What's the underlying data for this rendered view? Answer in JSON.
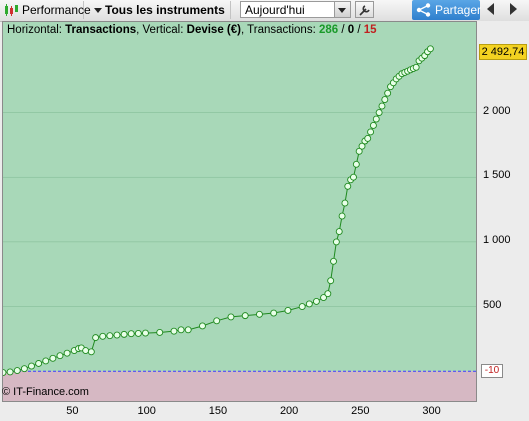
{
  "toolbar": {
    "performance_label": "Performance",
    "instruments_label": "Tous les instruments",
    "period_value": "Aujourd'hui",
    "share_label": "Partager"
  },
  "info": {
    "prefix": "Horizontal:",
    "horizontal": "Transactions",
    "vertical_prefix": ", Vertical:",
    "vertical": "Devise (€)",
    "tx_prefix": ", Transactions:",
    "tx_total": "286",
    "sep1": " / ",
    "tx_zero": "0",
    "sep2": " / ",
    "tx_loss": "15"
  },
  "credit": "© IT-Finance.com",
  "last_value_label": "2 492,74",
  "neg_label": "-10",
  "colors": {
    "profit_bg": "#a8d8b8",
    "loss_bg": "#d6b8c3",
    "line": "#1f8a1f",
    "marker": "#e8ffe8",
    "last_tag": "#f3d221"
  },
  "chart_data": {
    "type": "line",
    "y_ticks": [
      "500",
      "1 000",
      "1 500",
      "2 000"
    ],
    "x_ticks": [
      "50",
      "100",
      "150",
      "200",
      "250",
      "300"
    ],
    "xlim": [
      0,
      332
    ],
    "ylim": [
      -230,
      2700
    ],
    "x": [
      0,
      5,
      10,
      15,
      20,
      25,
      30,
      35,
      40,
      45,
      50,
      53,
      55,
      58,
      62,
      65,
      70,
      75,
      80,
      85,
      90,
      95,
      100,
      110,
      120,
      125,
      130,
      140,
      150,
      160,
      170,
      180,
      190,
      200,
      210,
      215,
      220,
      225,
      228,
      230,
      232,
      234,
      236,
      238,
      240,
      242,
      244,
      246,
      248,
      250,
      252,
      254,
      256,
      258,
      260,
      262,
      264,
      266,
      268,
      270,
      272,
      274,
      276,
      278,
      280,
      282,
      284,
      286,
      288,
      290,
      292,
      294,
      296,
      298,
      300
    ],
    "y": [
      -10,
      -5,
      5,
      20,
      40,
      60,
      80,
      100,
      120,
      140,
      160,
      175,
      180,
      160,
      150,
      260,
      270,
      275,
      280,
      285,
      290,
      292,
      295,
      300,
      310,
      320,
      320,
      350,
      390,
      420,
      430,
      440,
      450,
      470,
      500,
      520,
      540,
      570,
      600,
      700,
      850,
      1000,
      1080,
      1200,
      1300,
      1430,
      1480,
      1500,
      1600,
      1700,
      1740,
      1780,
      1800,
      1850,
      1900,
      1950,
      2000,
      2050,
      2100,
      2150,
      2200,
      2230,
      2260,
      2280,
      2300,
      2310,
      2320,
      2330,
      2340,
      2350,
      2400,
      2420,
      2440,
      2470,
      2492.74
    ]
  }
}
